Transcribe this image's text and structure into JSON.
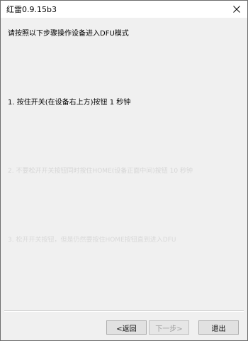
{
  "window": {
    "title": "红雷0.9.15b3"
  },
  "icons": {
    "close": "close-icon"
  },
  "content": {
    "instruction": "请按照以下步骤操作设备进入DFU模式",
    "step1": "1. 按住开关(在设备右上方)按钮 1 秒钟",
    "step2": "2. 不要松开开关按钮同时按住HOME(设备正面中间)按钮 10 秒钟",
    "step3": "3. 松开开关按钮，但是仍然要按住HOME按钮直到进入DFU"
  },
  "buttons": {
    "back": "<返回",
    "next": "下一步>",
    "exit": "退出"
  },
  "colors": {
    "window_bg": "#f0f0f0",
    "titlebar_bg": "#ffffff",
    "disabled_text": "#d6d6d6"
  }
}
